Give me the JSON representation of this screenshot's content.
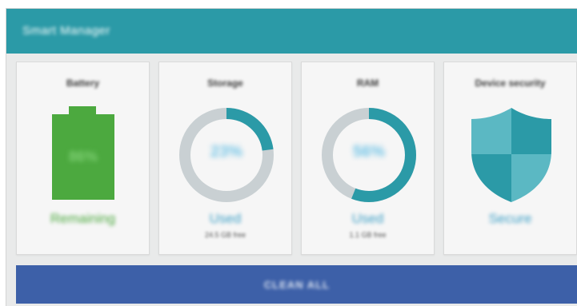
{
  "header": {
    "title": "Smart Manager"
  },
  "cards": {
    "battery": {
      "title": "Battery",
      "percent": "86%",
      "status": "Remaining",
      "level": 0.86,
      "color": "#4ca93f"
    },
    "storage": {
      "title": "Storage",
      "percent": "23%",
      "used_fraction": 0.23,
      "status": "Used",
      "detail": "24.5 GB free",
      "ring_color": "#2b9aa7",
      "track_color": "#c9d0d3"
    },
    "ram": {
      "title": "RAM",
      "percent": "56%",
      "used_fraction": 0.56,
      "status": "Used",
      "detail": "1.1 GB free",
      "ring_color": "#2b9aa7",
      "track_color": "#c9d0d3"
    },
    "security": {
      "title": "Device security",
      "status": "Secure",
      "icon": "shield-icon",
      "shield_dark": "#2b9aa7",
      "shield_light": "#5bb8c3"
    }
  },
  "actions": {
    "clean_all": "CLEAN ALL"
  },
  "colors": {
    "header": "#2b9aa7",
    "button": "#3d60a8",
    "background": "#e9eaea"
  }
}
